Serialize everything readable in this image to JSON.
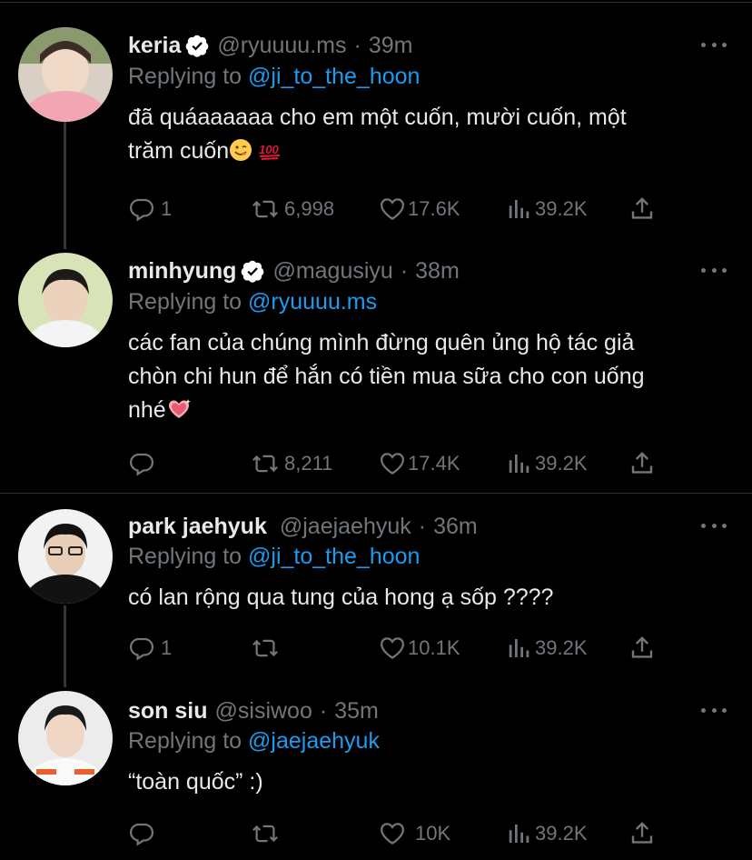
{
  "colors": {
    "background": "#000000",
    "text": "#e7e9ea",
    "muted": "#71767b",
    "accent": "#1d9bf0",
    "verified": "#ffffff"
  },
  "tweets": [
    {
      "name": "keria",
      "verified": true,
      "handle": "@ryuuuu.ms",
      "time": "39m",
      "reply_prefix": "Replying to",
      "reply_to": "@ji_to_the_hoon",
      "text_lines": [
        "đã quáaaaaaa cho em một cuốn, mười cuốn, một",
        "trăm cuốn"
      ],
      "emojis": [
        "smiling-face-icon",
        "hundred-points-icon"
      ],
      "replies": "1",
      "retweets": "6,998",
      "likes": "17.6K",
      "views": "39.2K"
    },
    {
      "name": "minhyung",
      "verified": true,
      "handle": "@magusiyu",
      "time": "38m",
      "reply_prefix": "Replying to",
      "reply_to": "@ryuuuu.ms",
      "text_lines": [
        "các fan của chúng mình đừng quên ủng hộ tác giả",
        "chòn chi hun để hắn có tiền mua sữa cho con uống",
        "nhé"
      ],
      "emojis": [
        "sparkling-heart-icon"
      ],
      "replies": "",
      "retweets": "8,211",
      "likes": "17.4K",
      "views": "39.2K"
    },
    {
      "name": "park jaehyuk",
      "verified": false,
      "handle": "@jaejaehyuk",
      "time": "36m",
      "reply_prefix": "Replying to",
      "reply_to": "@ji_to_the_hoon",
      "text_lines": [
        "có lan rộng qua tung của hong ạ sốp ????"
      ],
      "emojis": [],
      "replies": "1",
      "retweets": "",
      "likes": "10.1K",
      "views": "39.2K"
    },
    {
      "name": "son siu",
      "verified": false,
      "handle": "@sisiwoo",
      "time": "35m",
      "reply_prefix": "Replying to",
      "reply_to": "@jaejaehyuk",
      "text_lines": [
        "“toàn quốc” :)"
      ],
      "emojis": [],
      "replies": "",
      "retweets": "",
      "likes": "10K",
      "views": "39.2K"
    }
  ]
}
